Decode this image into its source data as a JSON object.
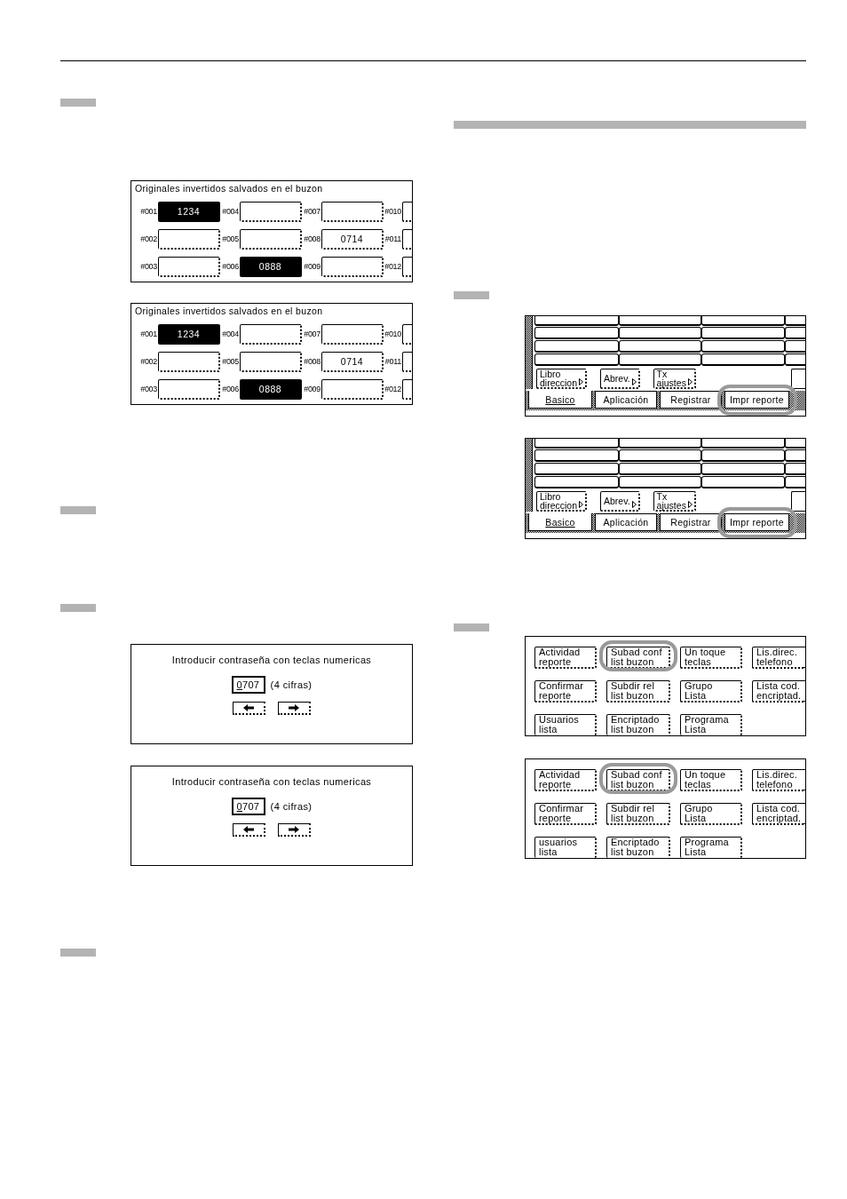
{
  "mailbox_panels": [
    {
      "title": "Originales invertidos salvados en el buzon",
      "boxes": [
        {
          "label": "#001",
          "value": "1234",
          "selected": true
        },
        {
          "label": "#004",
          "selected": false
        },
        {
          "label": "#007",
          "selected": false
        },
        {
          "label": "#010",
          "selected": false
        },
        {
          "label": "#002",
          "selected": false
        },
        {
          "label": "#005",
          "selected": false
        },
        {
          "label": "#008",
          "value": "0714",
          "selected": false
        },
        {
          "label": "#011",
          "selected": false
        },
        {
          "label": "#003",
          "selected": false
        },
        {
          "label": "#006",
          "value": "0888",
          "selected": true
        },
        {
          "label": "#009",
          "selected": false
        },
        {
          "label": "#012",
          "selected": false
        }
      ]
    },
    {
      "title": "Originales invertidos salvados en el buzon",
      "boxes": [
        {
          "label": "#001",
          "value": "1234",
          "selected": true
        },
        {
          "label": "#004",
          "selected": false
        },
        {
          "label": "#007",
          "selected": false
        },
        {
          "label": "#010",
          "selected": false
        },
        {
          "label": "#002",
          "selected": false
        },
        {
          "label": "#005",
          "selected": false
        },
        {
          "label": "#008",
          "value": "0714",
          "selected": false
        },
        {
          "label": "#011",
          "selected": false
        },
        {
          "label": "#003",
          "selected": false
        },
        {
          "label": "#006",
          "value": "0888",
          "selected": true
        },
        {
          "label": "#009",
          "selected": false
        },
        {
          "label": "#012",
          "selected": false
        }
      ]
    }
  ],
  "password_panels": [
    {
      "prompt": "Introducir contraseña con teclas numericas",
      "value": "0707",
      "note": "(4 cifras)"
    },
    {
      "prompt": "Introducir contraseña con teclas numericas",
      "value": "0707",
      "note": "(4 cifras)"
    }
  ],
  "tab_panels": [
    {
      "buttons": [
        {
          "label": "Libro\ndireccion"
        },
        {
          "label": "Abrev."
        },
        {
          "label": "Tx\najustes"
        }
      ],
      "tabs": [
        {
          "label": "Basico",
          "selected": true,
          "circled": false
        },
        {
          "label": "Aplicación",
          "selected": false,
          "circled": false
        },
        {
          "label": "Registrar",
          "selected": false,
          "circled": false
        },
        {
          "label": "Impr reporte",
          "selected": false,
          "circled": true
        }
      ]
    },
    {
      "buttons": [
        {
          "label": "Libro\ndireccion"
        },
        {
          "label": "Abrev."
        },
        {
          "label": "Tx\najustes"
        }
      ],
      "tabs": [
        {
          "label": "Basico",
          "selected": true,
          "circled": false
        },
        {
          "label": "Aplicación",
          "selected": false,
          "circled": false
        },
        {
          "label": "Registrar",
          "selected": false,
          "circled": false
        },
        {
          "label": "Impr reporte",
          "selected": false,
          "circled": true
        }
      ]
    }
  ],
  "report_panels": [
    {
      "buttons": [
        {
          "label": "Actividad\nreporte",
          "circled": false
        },
        {
          "label": "Subad conf\nlist buzon",
          "circled": true
        },
        {
          "label": "Un toque\nteclas",
          "circled": false
        },
        {
          "label": "Lis.direc.\ntelefono",
          "circled": false
        },
        {
          "label": "Confirmar\nreporte",
          "circled": false
        },
        {
          "label": "Subdir rel\nlist buzon",
          "circled": false
        },
        {
          "label": "Grupo\nLista",
          "circled": false
        },
        {
          "label": "Lista cod.\nencriptad.",
          "circled": false
        },
        {
          "label": "Usuarios\nlista",
          "circled": false
        },
        {
          "label": "Encriptado\nlist buzon",
          "circled": false
        },
        {
          "label": "Programa\nLista",
          "circled": false
        }
      ]
    },
    {
      "buttons": [
        {
          "label": "Actividad\nreporte",
          "circled": false
        },
        {
          "label": "Subad conf\nlist buzon",
          "circled": true
        },
        {
          "label": "Un toque\nteclas",
          "circled": false
        },
        {
          "label": "Lis.direc.\ntelefono",
          "circled": false
        },
        {
          "label": "Confirmar\nreporte",
          "circled": false
        },
        {
          "label": "Subdir rel\nlist buzon",
          "circled": false
        },
        {
          "label": "Grupo\nLista",
          "circled": false
        },
        {
          "label": "Lista cod.\nencriptad.",
          "circled": false
        },
        {
          "label": "usuarios\nlista",
          "circled": false
        },
        {
          "label": "Encriptado\nlist buzon",
          "circled": false
        },
        {
          "label": "Programa\nLista",
          "circled": false
        }
      ]
    }
  ]
}
